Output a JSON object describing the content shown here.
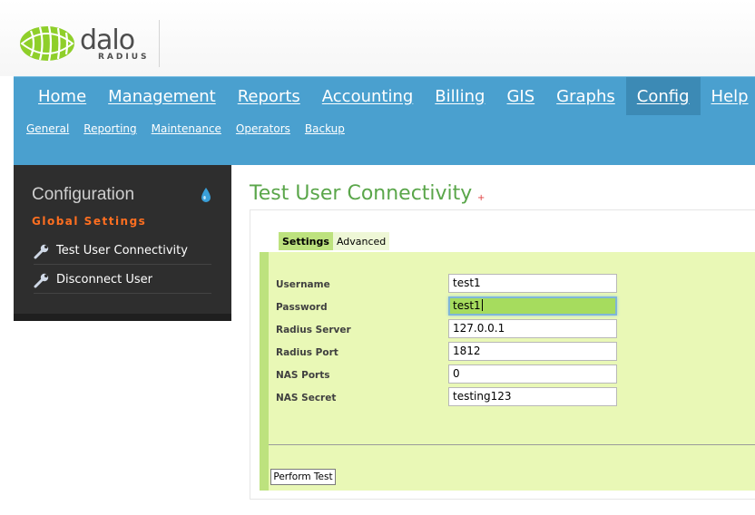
{
  "logo": {
    "wordmark": "dalo",
    "sub": "RADIUS"
  },
  "main_nav": [
    {
      "label": "Home"
    },
    {
      "label": "Management"
    },
    {
      "label": "Reports"
    },
    {
      "label": "Accounting"
    },
    {
      "label": "Billing"
    },
    {
      "label": "GIS"
    },
    {
      "label": "Graphs"
    },
    {
      "label": "Config",
      "active": true
    },
    {
      "label": "Help"
    }
  ],
  "sub_nav": [
    {
      "label": "General"
    },
    {
      "label": "Reporting"
    },
    {
      "label": "Maintenance"
    },
    {
      "label": "Operators"
    },
    {
      "label": "Backup"
    }
  ],
  "sidebar": {
    "title": "Configuration",
    "section": "Global Settings",
    "links": [
      {
        "label": "Test User Connectivity",
        "icon": "wrench-icon"
      },
      {
        "label": "Disconnect User",
        "icon": "wrench-icon"
      }
    ]
  },
  "page": {
    "title": "Test User Connectivity",
    "title_mark": "+"
  },
  "tabs": [
    {
      "label": "Settings",
      "active": true
    },
    {
      "label": "Advanced",
      "active": false
    }
  ],
  "form": {
    "fields": [
      {
        "label": "Username",
        "value": "test1"
      },
      {
        "label": "Password",
        "value": "test1",
        "focused": true
      },
      {
        "label": "Radius Server",
        "value": "127.0.0.1"
      },
      {
        "label": "Radius Port",
        "value": "1812"
      },
      {
        "label": "NAS Ports",
        "value": "0"
      },
      {
        "label": "NAS Secret",
        "value": "testing123"
      }
    ],
    "submit_label": "Perform Test"
  },
  "colors": {
    "nav_blue": "#4aa0cf",
    "nav_active": "#3c8ab5",
    "sidebar_bg": "#2e2e2e",
    "section_orange": "#ff6f20",
    "title_green": "#5aa64a",
    "panel_bg": "#e9f8b6",
    "panel_accent": "#bde27e"
  }
}
